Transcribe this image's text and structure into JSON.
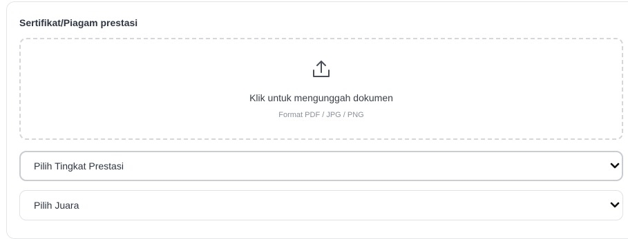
{
  "certificate_field": {
    "label": "Sertifikat/Piagam prestasi",
    "upload": {
      "icon": "upload-icon",
      "title": "Klik untuk mengunggah dokumen",
      "hint": "Format PDF / JPG / PNG"
    }
  },
  "selects": {
    "level": {
      "value": "Pilih Tingkat Prestasi",
      "icon": "chevron-down-icon"
    },
    "rank": {
      "value": "Pilih Juara",
      "icon": "chevron-down-icon"
    }
  }
}
